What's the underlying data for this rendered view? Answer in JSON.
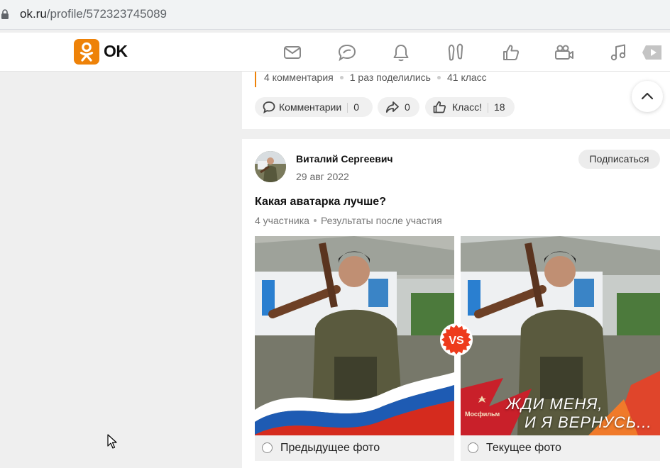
{
  "browser": {
    "url_host": "ok.ru",
    "url_path": "/profile/572323745089"
  },
  "header": {
    "logo_text": "OK",
    "nav_icons": [
      "messages-icon",
      "discussions-icon",
      "notifications-icon",
      "guests-icon",
      "marks-icon",
      "video-calls-icon",
      "music-icon",
      "video-icon"
    ]
  },
  "prev_post": {
    "comments_count_text": "4 комментария",
    "shares_text": "1 раз поделились",
    "likes_text": "41 класс",
    "comment_button_label": "Комментарии",
    "comment_button_count": "0",
    "share_button_count": "0",
    "like_button_label": "Класс!",
    "like_button_count": "18"
  },
  "post": {
    "author": "Виталий Сергеевич",
    "date": "29 авг 2022",
    "subscribe_label": "Подписаться",
    "question": "Какая аватарка лучше?",
    "participants": "4 участника",
    "results_note": "Результаты после участия",
    "vs_label": "VS",
    "options": [
      {
        "label": "Предыдущее фото"
      },
      {
        "label": "Текущее фото"
      }
    ],
    "option2_overlay_line1": "ЖДИ МЕНЯ,",
    "option2_overlay_line2": "И Я ВЕРНУСЬ...",
    "option2_brand": "Мосфильм"
  },
  "colors": {
    "accent": "#ee8208",
    "vs_badge": "#ee3b1c"
  }
}
